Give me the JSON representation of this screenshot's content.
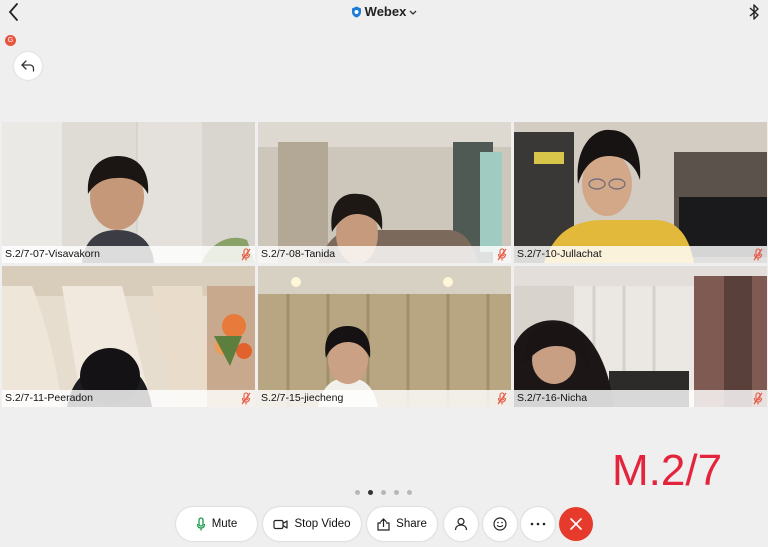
{
  "app": {
    "title": "Webex"
  },
  "notification": {
    "badge": "G"
  },
  "participants": [
    {
      "name": "S.2/7-07-Visavakorn",
      "muted": true
    },
    {
      "name": "S.2/7-08-Tanida",
      "muted": true
    },
    {
      "name": "S.2/7-10-Jullachat",
      "muted": true
    },
    {
      "name": "S.2/7-11-Peeradon",
      "muted": true
    },
    {
      "name": "S.2/7-15-jiecheng",
      "muted": true
    },
    {
      "name": "S.2/7-16-Nicha",
      "muted": true
    }
  ],
  "pagination": {
    "pages": 5,
    "current": 2
  },
  "overlay": {
    "text": "M.2/7",
    "color": "#e4243c"
  },
  "toolbar": {
    "mute_label": "Mute",
    "stop_video_label": "Stop Video",
    "share_label": "Share"
  },
  "colors": {
    "end_call": "#e53a2c",
    "muted_icon": "#e8553f"
  },
  "icons": {
    "back": "chevron-left-icon",
    "title": "shield-icon",
    "bluetooth": "bluetooth-icon",
    "return": "return-arrow-icon",
    "mute": "microphone-icon",
    "video": "video-camera-icon",
    "share": "share-icon",
    "participants": "participants-icon",
    "reactions": "smiley-icon",
    "more": "more-icon",
    "end": "close-icon"
  }
}
